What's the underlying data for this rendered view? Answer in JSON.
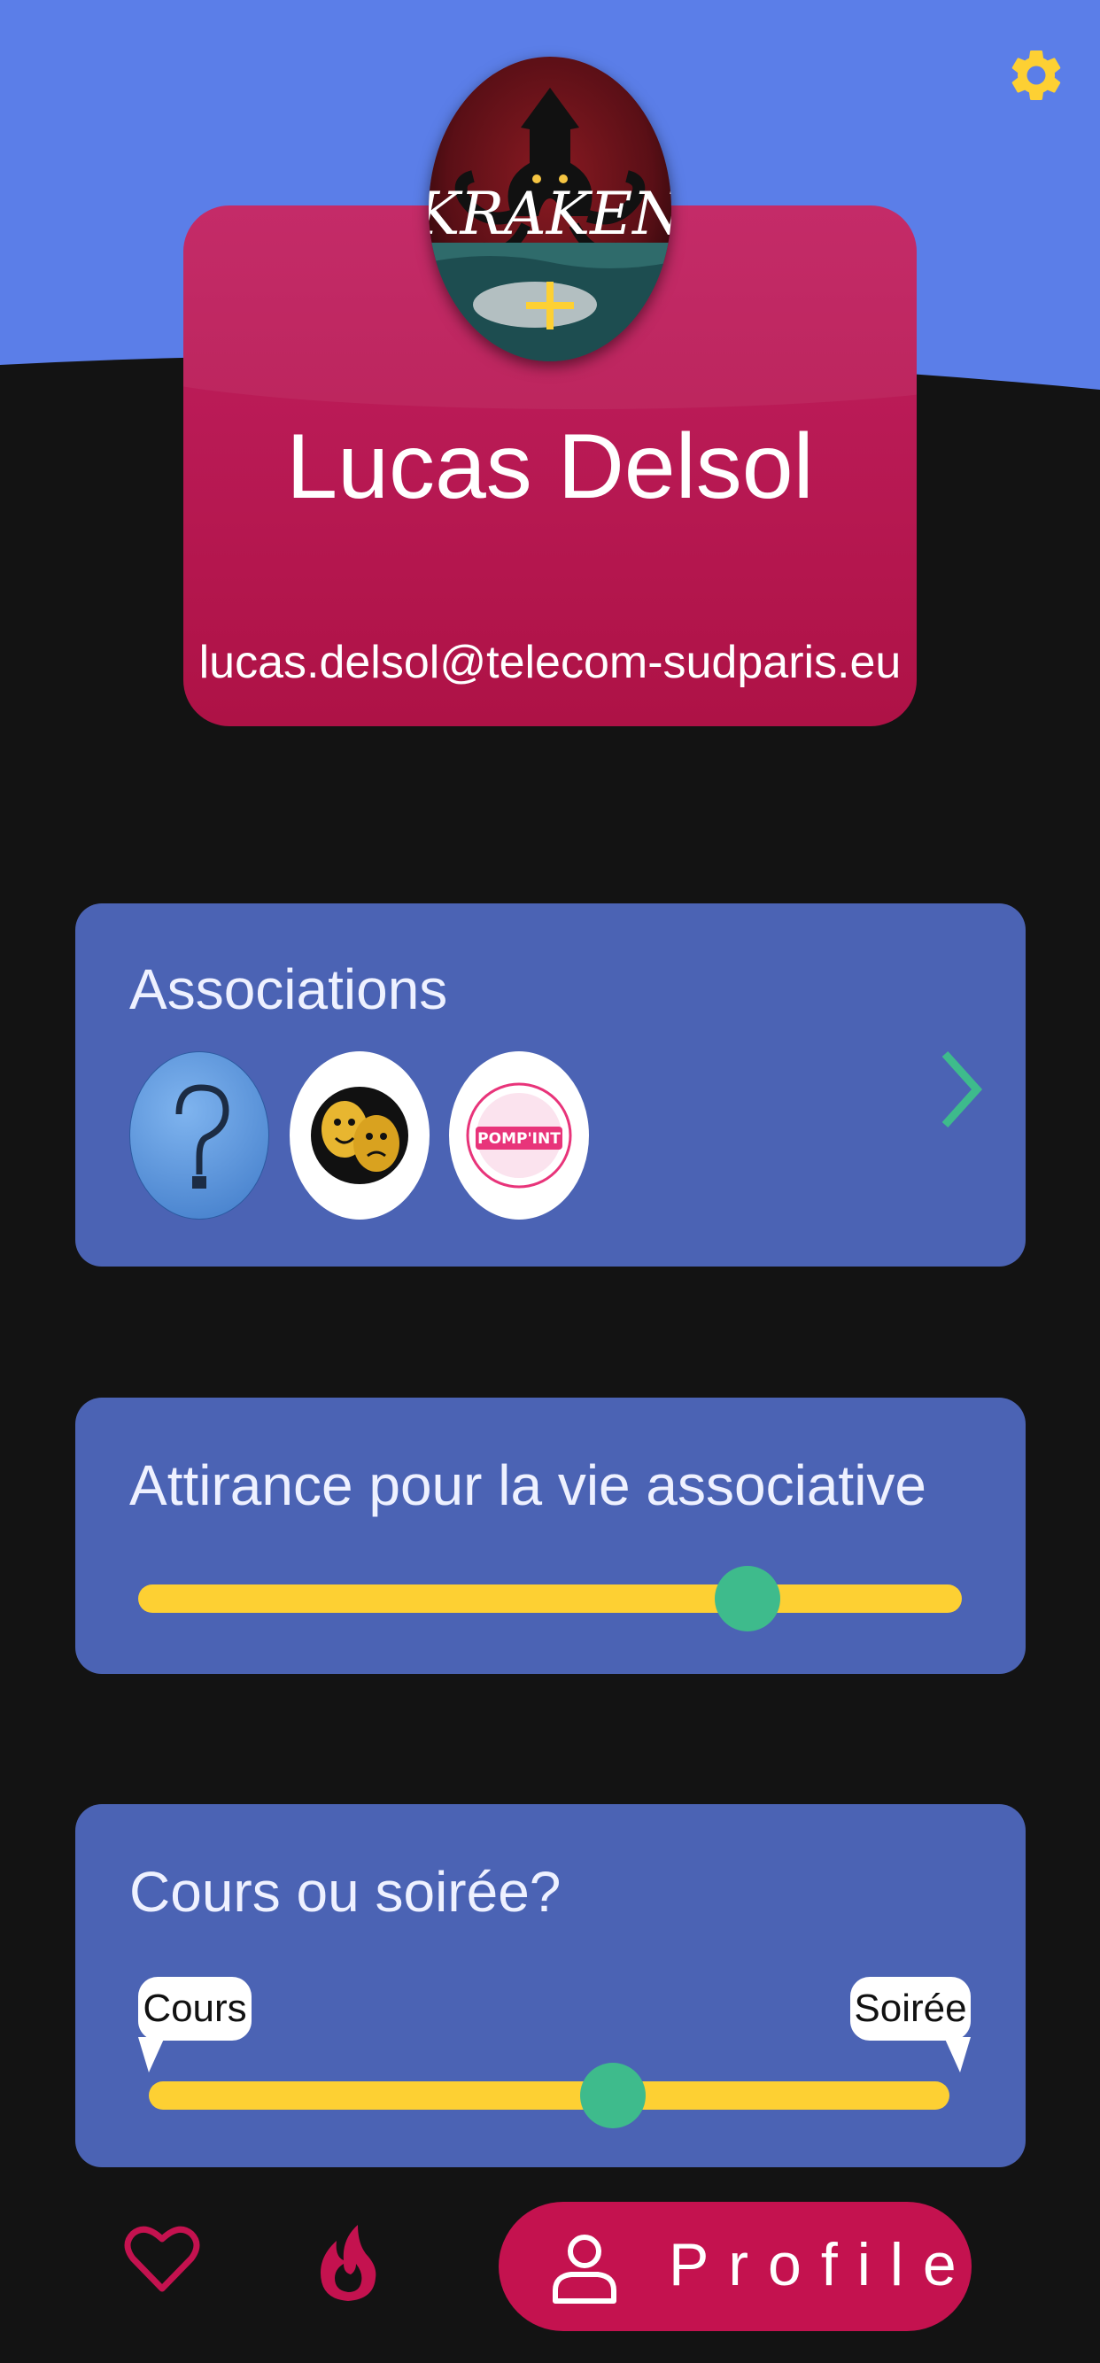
{
  "colors": {
    "header_blue": "#5b7ee8",
    "background": "#131313",
    "profile_card": "#b8175a",
    "panel_blue": "#4b63b4",
    "slider_track": "#fdd033",
    "slider_thumb": "#3ebb8c",
    "accent_gold": "#fdd033",
    "nav_active": "#c4124f"
  },
  "header": {
    "settings_icon": "gear-icon"
  },
  "profile": {
    "avatar_text": "KRAKEN",
    "avatar_add_symbol": "+",
    "name": "Lucas Delsol",
    "email": "lucas.delsol@telecom-sudparis.eu"
  },
  "associations": {
    "title": "Associations",
    "logos": [
      {
        "icon": "question-mark-logo"
      },
      {
        "icon": "theater-masks-logo"
      },
      {
        "icon": "pompint-logo",
        "text": "POMP'INT"
      }
    ],
    "more_icon": "chevron-right-icon"
  },
  "attraction": {
    "title": "Attirance pour la vie associative",
    "value": 0.74
  },
  "course_or_party": {
    "title": "Cours ou soirée?",
    "left_label": "Cours",
    "right_label": "Soirée",
    "value": 0.58
  },
  "bottom_nav": {
    "items": [
      {
        "icon": "heart-icon"
      },
      {
        "icon": "flame-icon"
      },
      {
        "icon": "person-icon",
        "label": "Profile",
        "active": true
      }
    ]
  }
}
